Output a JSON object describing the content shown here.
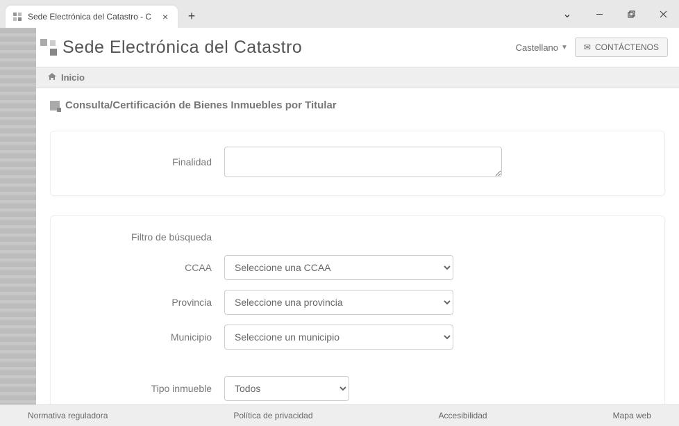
{
  "browser": {
    "tab_title": "Sede Electrónica del Catastro - C"
  },
  "header": {
    "site_title": "Sede Electrónica del Catastro",
    "language": "Castellano",
    "contact_label": "CONTÁCTENOS"
  },
  "breadcrumb": {
    "home": "Inicio"
  },
  "page": {
    "heading": "Consulta/Certificación de Bienes Inmuebles por Titular"
  },
  "form": {
    "finalidad_label": "Finalidad",
    "finalidad_value": "",
    "filter_section_label": "Filtro de búsqueda",
    "ccaa_label": "CCAA",
    "ccaa_selected": "Seleccione una CCAA",
    "provincia_label": "Provincia",
    "provincia_selected": "Seleccione una provincia",
    "municipio_label": "Municipio",
    "municipio_selected": "Seleccione un municipio",
    "tipo_inmueble_label": "Tipo inmueble",
    "tipo_inmueble_selected": "Todos"
  },
  "footer": {
    "normativa": "Normativa reguladora",
    "privacidad": "Política de privacidad",
    "accesibilidad": "Accesibilidad",
    "mapa": "Mapa web"
  }
}
